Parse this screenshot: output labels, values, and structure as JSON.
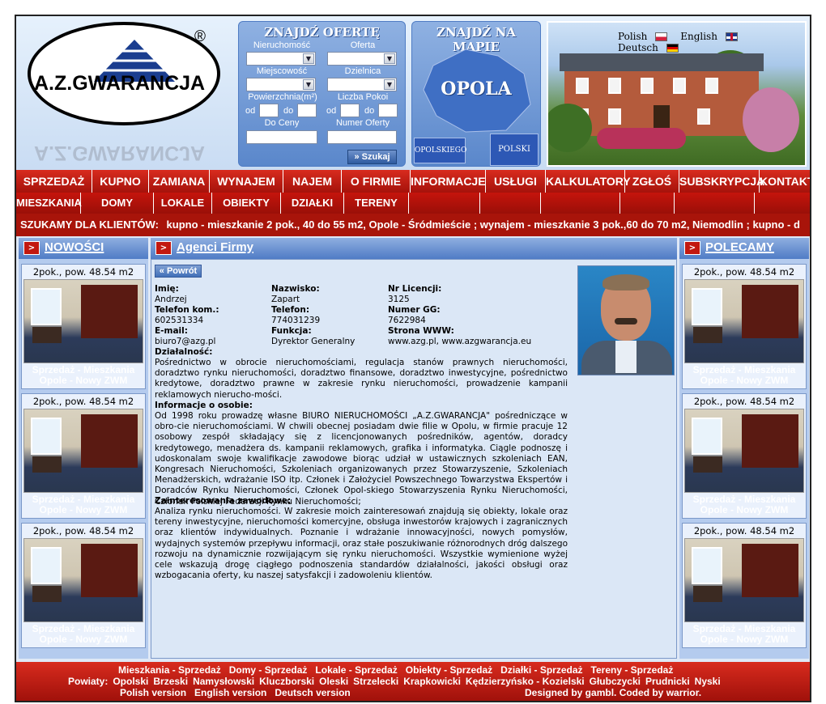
{
  "logo": {
    "text": "A.Z.GWARANCJA",
    "reg": "®"
  },
  "search": {
    "title": "ZNAJDŹ OFERTĘ",
    "labels": {
      "property": "Nieruchomość",
      "offer": "Oferta",
      "city": "Miejscowość",
      "district": "Dzielnica",
      "area": "Powierzchnia(m²)",
      "rooms": "Liczba Pokoi",
      "price_to": "Do Ceny",
      "offer_no": "Numer Oferty"
    },
    "od": "od",
    "do": "do",
    "button": "» Szukaj"
  },
  "map": {
    "title": "ZNAJDŹ NA MAPIE",
    "city": "OPOLA",
    "region": "OPOLSKIEGO",
    "country": "POLSKI"
  },
  "languages": [
    {
      "label": "Polish",
      "flag": "pl-flag-icon"
    },
    {
      "label": "English",
      "flag": "uk-flag-icon"
    },
    {
      "label": "Deutsch",
      "flag": "de-flag-icon"
    }
  ],
  "menu_main": [
    "SPRZEDAŻ",
    "KUPNO",
    "ZAMIANA",
    "WYNAJEM",
    "NAJEM",
    "O FIRMIE",
    "INFORMACJE",
    "USŁUGI",
    "KALKULATORY",
    "ZGŁOŚ",
    "SUBSKRYPCJA",
    "KONTAKT"
  ],
  "menu_sub": [
    "MIESZKANIA",
    "DOMY",
    "LOKALE",
    "OBIEKTY",
    "DZIAŁKI",
    "TERENY"
  ],
  "ticker": {
    "lead": "SZUKAMY DLA KLIENTÓW:",
    "text": "kupno - mieszkanie 2 pok., 40 do 55 m2, Opole - Śródmieście ; wynajem - mieszkanie 3 pok.,60 do 70 m2, Niemodlin ; kupno - d"
  },
  "left_col": {
    "title": "NOWOŚCI",
    "cards": [
      {
        "title": "2pok., pow. 48.54 m2",
        "line1": "Sprzedaż - Mieszkania",
        "line2": "Opole - Nowy ZWM"
      },
      {
        "title": "2pok., pow. 48.54 m2",
        "line1": "Sprzedaż - Mieszkania",
        "line2": "Opole - Nowy ZWM"
      },
      {
        "title": "2pok., pow. 48.54 m2",
        "line1": "Sprzedaż - Mieszkania",
        "line2": "Opole - Nowy ZWM"
      }
    ]
  },
  "right_col": {
    "title": "POLECAMY",
    "cards": [
      {
        "title": "2pok., pow. 48.54 m2",
        "line1": "Sprzedaż - Mieszkania",
        "line2": "Opole - Nowy ZWM"
      },
      {
        "title": "2pok., pow. 48.54 m2",
        "line1": "Sprzedaż - Mieszkania",
        "line2": "Opole - Nowy ZWM"
      },
      {
        "title": "2pok., pow. 48.54 m2",
        "line1": "Sprzedaż - Mieszkania",
        "line2": "Opole - Nowy ZWM"
      }
    ]
  },
  "center": {
    "title": "Agenci Firmy",
    "back": "« Powrót",
    "fields": {
      "imie_l": "Imię:",
      "imie_v": "Andrzej",
      "nazwisko_l": "Nazwisko:",
      "nazwisko_v": "Zapart",
      "licencja_l": "Nr Licencji:",
      "licencja_v": "3125",
      "telkom_l": "Telefon kom.:",
      "telkom_v": "602531334",
      "tel_l": "Telefon:",
      "tel_v": "774031239",
      "gg_l": "Numer GG:",
      "gg_v": "7622984",
      "email_l": "E-mail:",
      "email_v": "biuro7@azg.pl",
      "funkcja_l": "Funkcja:",
      "funkcja_v": "Dyrektor Generalny",
      "www_l": "Strona WWW:",
      "www_v": "www.azg.pl, www.azgwarancja.eu"
    },
    "dzialalnosc_l": "Działalność:",
    "dzialalnosc": "Pośrednictwo w obrocie nieruchomościami, regulacja stanów prawnych nieruchomości, doradztwo rynku nieruchomości, doradztwo finansowe, doradztwo inwestycyjne, pośrednictwo kredytowe, doradztwo prawne w zakresie rynku nieruchomości, prowadzenie kampanii reklamowych nierucho-mości.",
    "info_l": "Informacje o osobie:",
    "info": "Od 1998 roku prowadzę własne BIURO NIERUCHOMOŚCI „A.Z.GWARANCJA\" pośredniczące w obro-cie nieruchomościami. W chwili obecnej posiadam dwie filie w Opolu, w firmie pracuje 12 osobowy zespół składający się z licencjonowanych pośredników, agentów, doradcy kredytowego, menadżera ds. kampanii reklamowych, grafika i informatyka. Ciągle podnoszę i udoskonalam swoje kwalifikacje zawodowe biorąc udział w ustawicznych szkoleniach EAN, Kongresach Nieruchomości, Szkoleniach organizowanych przez Stowarzyszenie, Szkoleniach Menadżerskich, wdrażanie ISO itp. Członek i Założyciel Powszechnego Towarzystwa Ekspertów i Doradców Rynku Nieruchomości, Członek Opol-skiego Stowarzyszenia Rynku Nieruchomości, Członek Polskiej Federacji Rynku Nieruchomości;",
    "zaint_l": "Zainteresowania zawodowe:",
    "zaint": "Analiza rynku nieruchomości. W zakresie moich zainteresowań znajdują się obiekty, lokale oraz tereny inwestycyjne, nieruchomości komercyjne, obsługa inwestorów krajowych i zagranicznych oraz klientów indywidualnych. Poznanie i wdrażanie innowacyjności, nowych pomysłów, wydajnych systemów przepływu informacji, oraz stałe poszukiwanie różnorodnych dróg dalszego rozwoju na dynamicznie rozwijającym się rynku nieruchomości. Wszystkie wymienione wyżej cele wskazują drogę ciągłego podnoszenia standardów działalności, jakości obsługi oraz wzbogacania oferty, ku naszej satysfakcji i zadowoleniu klientów."
  },
  "footer": {
    "row1": [
      "Mieszkania - Sprzedaż",
      "Domy - Sprzedaż",
      "Lokale - Sprzedaż",
      "Obiekty - Sprzedaż",
      "Działki - Sprzedaż",
      "Tereny - Sprzedaż"
    ],
    "powiaty_label": "Powiaty:",
    "powiaty": [
      "Opolski",
      "Brzeski",
      "Namysłowski",
      "Kluczborski",
      "Oleski",
      "Strzelecki",
      "Krapkowicki",
      "Kędzierzyńsko - Kozielski",
      "Głubczycki",
      "Prudnicki",
      "Nyski"
    ],
    "versions": [
      "Polish version",
      "English version",
      "Deutsch version"
    ],
    "credits": "Designed by gambl. Coded by warrior."
  },
  "colors": {
    "menu_red": "#c41a10",
    "panel_blue": "#5a87cb",
    "accent": "#b4cbee"
  }
}
